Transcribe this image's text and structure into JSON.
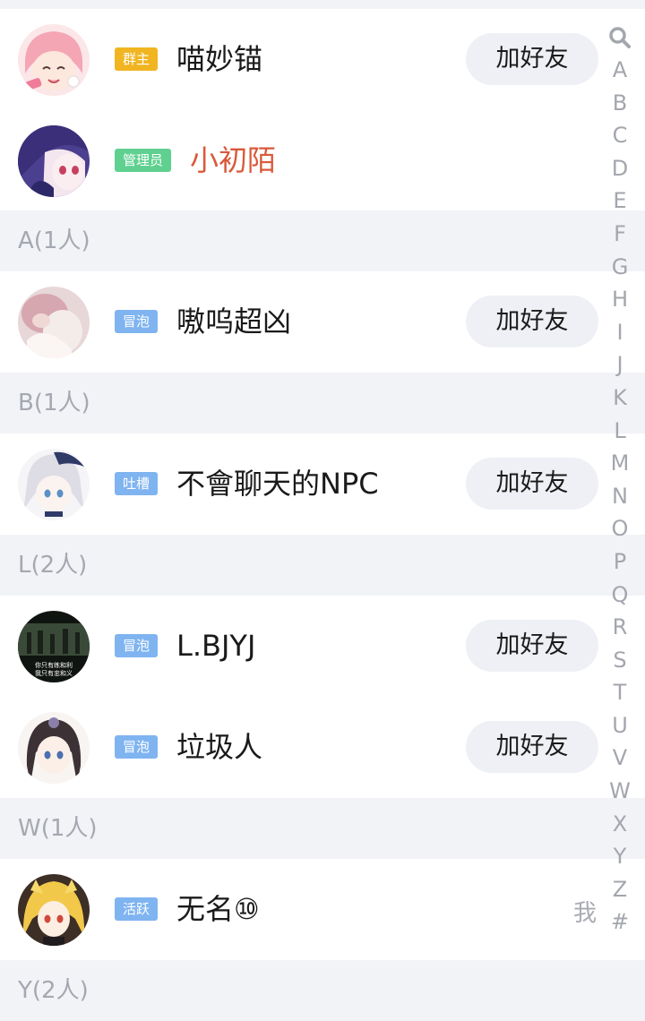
{
  "rows": {
    "owner": {
      "badge": "群主",
      "badge_color": "#f1b521",
      "name": "喵妙锚",
      "button": "加好友"
    },
    "admin": {
      "badge": "管理员",
      "badge_color": "#5fd08f",
      "name": "小初陌"
    },
    "a1": {
      "badge": "冒泡",
      "badge_color": "#7fb4f0",
      "name": "嗷呜超凶",
      "button": "加好友"
    },
    "b1": {
      "badge": "吐槽",
      "badge_color": "#7fb4f0",
      "name": "不會聊天的NPC",
      "button": "加好友"
    },
    "l1": {
      "badge": "冒泡",
      "badge_color": "#7fb4f0",
      "name": "L.BJYJ",
      "button": "加好友",
      "avatar_line1": "你只有练和利",
      "avatar_line2": "我只有忠和义"
    },
    "l2": {
      "badge": "冒泡",
      "badge_color": "#7fb4f0",
      "name": "垃圾人",
      "button": "加好友"
    },
    "w1": {
      "badge": "活跃",
      "badge_color": "#7fb4f0",
      "name": "无名⑩",
      "me": "我"
    }
  },
  "sections": {
    "a": "A(1人)",
    "b": "B(1人)",
    "l": "L(2人)",
    "w": "W(1人)",
    "y": "Y(2人)"
  },
  "index": {
    "icon": "search-icon",
    "letters": [
      "A",
      "B",
      "C",
      "D",
      "E",
      "F",
      "G",
      "H",
      "I",
      "J",
      "K",
      "L",
      "M",
      "N",
      "O",
      "P",
      "Q",
      "R",
      "S",
      "T",
      "U",
      "V",
      "W",
      "X",
      "Y",
      "Z",
      "#"
    ]
  }
}
